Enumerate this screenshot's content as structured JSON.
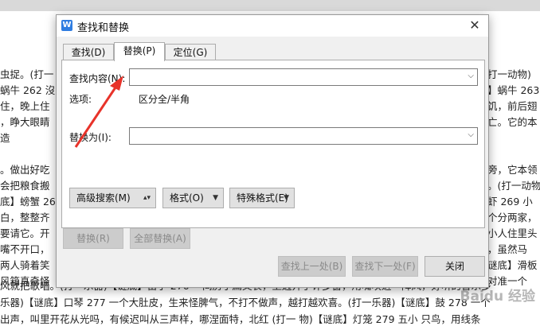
{
  "background_doc": {
    "left_lines": [
      "虫捉。(打一",
      "蜗牛 262  沒",
      "住，晚上住",
      "，睁大眼睛",
      "造",
      "",
      "。做出好吃",
      "会把粮食搬",
      "底】螃蟹 26",
      "白，整整齐",
      "要请它。开",
      "嘴不开口，",
      "两人骑着笑",
      "风箱真奇怪"
    ],
    "right_lines": [
      "打一动物)",
      "】蜗牛 263",
      "饥，前后翅",
      "亡。它的本",
      "",
      "",
      "旁，它本领",
      "。(打一动物",
      "虾 269 小",
      "个分两家，",
      "小人住里头",
      "，虽然马",
      "谜底】滑板",
      "对准一个"
    ],
    "bottom_lines": [
      "风就把歌唱。(打一乐器)【谜底】笛子 276  一间房子扁又长，上边开了许多窗，用嘴吹进一阵风，好听的音乐多",
      "乐器)【谜底】口琴 277  一个大肚皮，生来怪脾气，不打不做声，越打越欢喜。(打一乐器)【谜底】鼓 278  一个",
      "出声，叫里开花从光吗，有候迟叫从三声样，哪涅面特，北红    (打一   物)【谜底】灯笼 279  五小  只鸟，用线条"
    ],
    "watermark": "Baidu 经验"
  },
  "dialog": {
    "icon": "wps-writer-icon",
    "icon_glyph": "W",
    "title": "查找和替换",
    "close_glyph": "✕",
    "tabs": [
      {
        "label": "查找(D)",
        "active": false
      },
      {
        "label": "替换(P)",
        "active": true
      },
      {
        "label": "定位(G)",
        "active": false
      }
    ],
    "find_label": "查找内容(N):",
    "find_value": "",
    "options_label": "选项:",
    "options_value": "区分全/半角",
    "replace_label": "替换为(I):",
    "replace_value": "",
    "combo_arrow": "⌵",
    "advanced_search": "高级搜索(M)",
    "format": "格式(O)",
    "special_format": "特殊格式(E)",
    "replace_btn": "替换(R)",
    "replace_all_btn": "全部替换(A)",
    "find_prev_btn": "查找上一处(B)",
    "find_next_btn": "查找下一处(F)",
    "close_btn": "关闭"
  },
  "colors": {
    "annotation_arrow": "#e8332a",
    "app_icon": "#2f7de1"
  }
}
